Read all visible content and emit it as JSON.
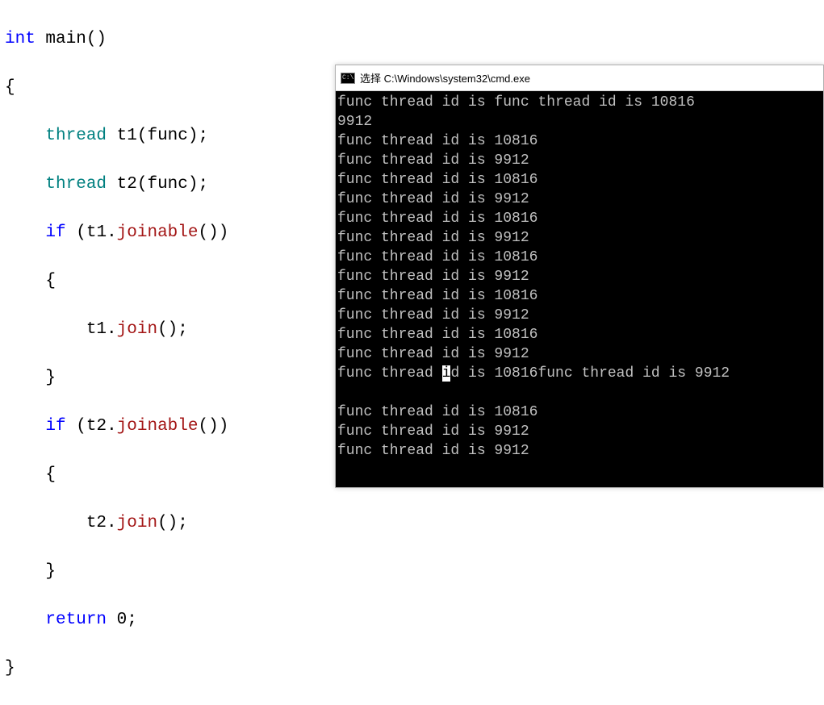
{
  "code": {
    "l1_kw": "int",
    "l1_fn": " main",
    "l1_paren": "()",
    "l2": "{",
    "l3_type": "thread",
    "l3_var": " t1",
    "l3_rest": "(func);",
    "l4_type": "thread",
    "l4_var": " t2",
    "l4_rest": "(func);",
    "l5_if": "if",
    "l5_paren1": " (",
    "l5_var": "t1.",
    "l5_method": "joinable",
    "l5_paren2": "())",
    "l6": "{",
    "l7_var": "t1.",
    "l7_method": "join",
    "l7_end": "();",
    "l8": "}",
    "l9_if": "if",
    "l9_paren1": " (",
    "l9_var": "t2.",
    "l9_method": "joinable",
    "l9_paren2": "())",
    "l10": "{",
    "l11_var": "t2.",
    "l11_method": "join",
    "l11_end": "();",
    "l12": "}",
    "l13_kw": "return",
    "l13_val": " 0;",
    "l14": "}"
  },
  "console": {
    "icon_text": "C:\\",
    "title": "选择 C:\\Windows\\system32\\cmd.exe",
    "lines": [
      "func thread id is func thread id is 10816",
      "9912",
      "func thread id is 10816",
      "func thread id is 9912",
      "func thread id is 10816",
      "func thread id is 9912",
      "func thread id is 10816",
      "func thread id is 9912",
      "func thread id is 10816",
      "func thread id is 9912",
      "func thread id is 10816",
      "func thread id is 9912",
      "func thread id is 10816",
      "func thread id is 9912"
    ],
    "hl_line_pre": "func thread ",
    "hl_char": "i",
    "hl_line_post": "d is 10816func thread id is 9912",
    "after_lines": [
      "",
      "func thread id is 10816",
      "func thread id is 9912",
      "func thread id is 9912"
    ]
  }
}
